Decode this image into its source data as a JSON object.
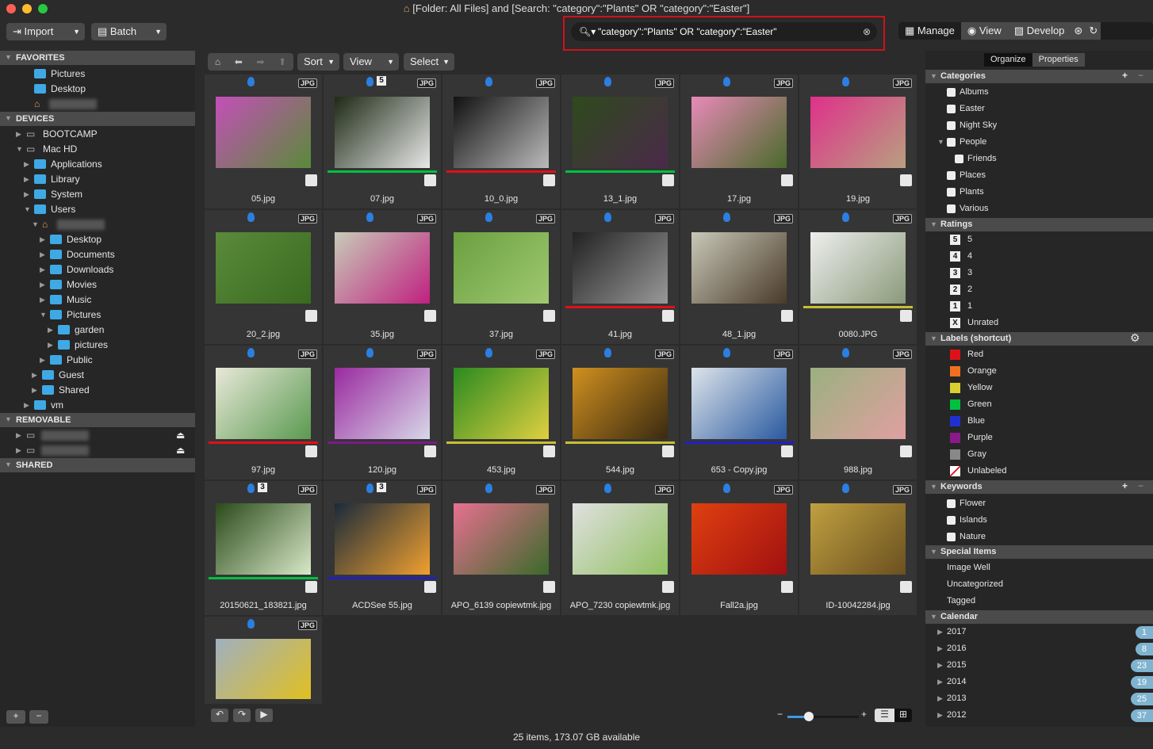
{
  "window": {
    "title": "[Folder: All Files] and [Search: \"category\":\"Plants\" OR \"category\":\"Easter\"]"
  },
  "toolbar": {
    "import": "Import",
    "batch": "Batch",
    "search_value": "\"category\":\"Plants\" OR \"category\":\"Easter\"",
    "modes": [
      "Manage",
      "View",
      "Develop"
    ]
  },
  "browser_toolbar": {
    "sort": "Sort",
    "view": "View",
    "select": "Select"
  },
  "left": {
    "sections": [
      {
        "label": "FAVORITES"
      },
      {
        "label": "DEVICES"
      },
      {
        "label": "REMOVABLE"
      },
      {
        "label": "SHARED"
      }
    ],
    "favorites": [
      "Pictures",
      "Desktop"
    ],
    "devices": [
      {
        "label": "BOOTCAMP",
        "level": 0
      },
      {
        "label": "Mac HD",
        "level": 0
      },
      {
        "label": "Applications",
        "level": 1
      },
      {
        "label": "Library",
        "level": 1
      },
      {
        "label": "System",
        "level": 1
      },
      {
        "label": "Users",
        "level": 1
      },
      {
        "label": "",
        "level": 2,
        "home": true
      },
      {
        "label": "Desktop",
        "level": 3
      },
      {
        "label": "Documents",
        "level": 3
      },
      {
        "label": "Downloads",
        "level": 3
      },
      {
        "label": "Movies",
        "level": 3
      },
      {
        "label": "Music",
        "level": 3
      },
      {
        "label": "Pictures",
        "level": 3
      },
      {
        "label": "garden",
        "level": 4
      },
      {
        "label": "pictures",
        "level": 4
      },
      {
        "label": "Public",
        "level": 3
      },
      {
        "label": "Guest",
        "level": 2
      },
      {
        "label": "Shared",
        "level": 2
      },
      {
        "label": "vm",
        "level": 1
      }
    ]
  },
  "items": [
    {
      "name": "05.jpg",
      "rating": "",
      "label": "",
      "colors": [
        "#c44fb8",
        "#5a8a3a"
      ]
    },
    {
      "name": "07.jpg",
      "rating": "5",
      "label": "#00c040",
      "colors": [
        "#1d2a15",
        "#e8e8e8"
      ]
    },
    {
      "name": "10_0.jpg",
      "rating": "",
      "label": "#e0101a",
      "colors": [
        "#111",
        "#bbb"
      ]
    },
    {
      "name": "13_1.jpg",
      "rating": "",
      "label": "#00c040",
      "colors": [
        "#2e4a1c",
        "#4a2a4a"
      ]
    },
    {
      "name": "17.jpg",
      "rating": "",
      "label": "",
      "colors": [
        "#e88ab8",
        "#4a6a2a"
      ]
    },
    {
      "name": "19.jpg",
      "rating": "",
      "label": "",
      "colors": [
        "#e0308a",
        "#b8a080"
      ]
    },
    {
      "name": "20_2.jpg",
      "rating": "",
      "label": "",
      "colors": [
        "#5a8a3a",
        "#3a6a20"
      ]
    },
    {
      "name": "35.jpg",
      "rating": "",
      "label": "",
      "colors": [
        "#c8cbb8",
        "#c02080"
      ]
    },
    {
      "name": "37.jpg",
      "rating": "",
      "label": "",
      "colors": [
        "#6aa040",
        "#a0c870"
      ]
    },
    {
      "name": "41.jpg",
      "rating": "",
      "label": "#e0101a",
      "colors": [
        "#222",
        "#999"
      ]
    },
    {
      "name": "48_1.jpg",
      "rating": "",
      "label": "",
      "colors": [
        "#c8c8b8",
        "#4a3a2a"
      ]
    },
    {
      "name": "0080.JPG",
      "rating": "",
      "label": "#c8c030",
      "colors": [
        "#eee",
        "#8a9a7a"
      ]
    },
    {
      "name": "97.jpg",
      "rating": "",
      "label": "#e0101a",
      "colors": [
        "#e8e8d8",
        "#5a9a50"
      ]
    },
    {
      "name": "120.jpg",
      "rating": "",
      "label": "#7a1a8a",
      "colors": [
        "#9a2aa0",
        "#d8d8e8"
      ]
    },
    {
      "name": "453.jpg",
      "rating": "",
      "label": "#c8c030",
      "colors": [
        "#2a8a20",
        "#e0d040"
      ]
    },
    {
      "name": "544.jpg",
      "rating": "",
      "label": "#c8c030",
      "colors": [
        "#d09020",
        "#3a2a10"
      ]
    },
    {
      "name": "653 - Copy.jpg",
      "rating": "",
      "label": "#2020c0",
      "colors": [
        "#dde4ea",
        "#2a5aa0"
      ]
    },
    {
      "name": "988.jpg",
      "rating": "",
      "label": "",
      "colors": [
        "#9ab080",
        "#e0a0a0"
      ]
    },
    {
      "name": "20150621_183821.jpg",
      "rating": "3",
      "label": "#00c040",
      "colors": [
        "#2a4a1a",
        "#d8e8c8"
      ]
    },
    {
      "name": "ACDSee 55.jpg",
      "rating": "3",
      "label": "#2020c0",
      "colors": [
        "#1a2a3a",
        "#f0a030"
      ]
    },
    {
      "name": "APO_6139 copiewtmk.jpg",
      "rating": "",
      "label": "",
      "colors": [
        "#e87090",
        "#3a6a2a"
      ]
    },
    {
      "name": "APO_7230 copiewtmk.jpg",
      "rating": "",
      "label": "",
      "colors": [
        "#e0e0e0",
        "#90c060"
      ]
    },
    {
      "name": "Fall2a.jpg",
      "rating": "",
      "label": "",
      "colors": [
        "#e04010",
        "#a01010"
      ]
    },
    {
      "name": "ID-10042284.jpg",
      "rating": "",
      "label": "",
      "colors": [
        "#c0a040",
        "#6a5020"
      ]
    },
    {
      "name": "",
      "rating": "",
      "label": "",
      "colors": [
        "#a0b0c0",
        "#e0c020"
      ]
    }
  ],
  "file_badge": "JPG",
  "right": {
    "tabs": [
      "Organize",
      "Properties"
    ],
    "categories": {
      "title": "Categories",
      "items": [
        {
          "label": "Albums",
          "level": 0
        },
        {
          "label": "Easter",
          "level": 0
        },
        {
          "label": "Night Sky",
          "level": 0
        },
        {
          "label": "People",
          "level": 0,
          "open": true
        },
        {
          "label": "Friends",
          "level": 1
        },
        {
          "label": "Places",
          "level": 0
        },
        {
          "label": "Plants",
          "level": 0
        },
        {
          "label": "Various",
          "level": 0
        }
      ]
    },
    "ratings": {
      "title": "Ratings",
      "items": [
        {
          "badge": "5",
          "label": "5"
        },
        {
          "badge": "4",
          "label": "4"
        },
        {
          "badge": "3",
          "label": "3"
        },
        {
          "badge": "2",
          "label": "2"
        },
        {
          "badge": "1",
          "label": "1"
        },
        {
          "badge": "X",
          "label": "Unrated"
        }
      ]
    },
    "labels": {
      "title": "Labels (shortcut)",
      "items": [
        {
          "label": "Red",
          "color": "#e0101a"
        },
        {
          "label": "Orange",
          "color": "#f07020"
        },
        {
          "label": "Yellow",
          "color": "#d8d030"
        },
        {
          "label": "Green",
          "color": "#00c040"
        },
        {
          "label": "Blue",
          "color": "#2030d0"
        },
        {
          "label": "Purple",
          "color": "#8a1a8a"
        },
        {
          "label": "Gray",
          "color": "#888888"
        },
        {
          "label": "Unlabeled",
          "color": "#ffffff"
        }
      ]
    },
    "keywords": {
      "title": "Keywords",
      "items": [
        "Flower",
        "Islands",
        "Nature"
      ]
    },
    "special": {
      "title": "Special Items",
      "items": [
        "Image Well",
        "Uncategorized",
        "Tagged"
      ]
    },
    "calendar": {
      "title": "Calendar",
      "items": [
        {
          "year": "2017",
          "count": "1"
        },
        {
          "year": "2016",
          "count": "8"
        },
        {
          "year": "2015",
          "count": "23"
        },
        {
          "year": "2014",
          "count": "19"
        },
        {
          "year": "2013",
          "count": "25"
        },
        {
          "year": "2012",
          "count": "37"
        }
      ]
    }
  },
  "thumbnail_size_percent": 30,
  "status": "25 items, 173.07 GB available"
}
